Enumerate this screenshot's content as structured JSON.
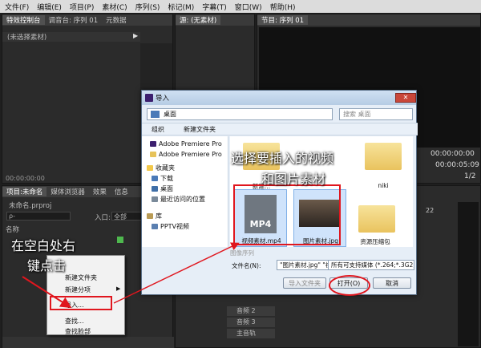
{
  "menubar": [
    "文件(F)",
    "编辑(E)",
    "项目(P)",
    "素材(C)",
    "序列(S)",
    "标记(M)",
    "字幕(T)",
    "窗口(W)",
    "帮助(H)"
  ],
  "left_panel": {
    "tabs": [
      "特效控制台",
      "调音台: 序列 01",
      "元数据"
    ],
    "no_selection": "(未选择素材)",
    "timecode": "00:00:00:00"
  },
  "source_panel": {
    "tab": "源: (无素材)"
  },
  "program_panel": {
    "tab": "节目: 序列 01",
    "timecode1": "00:00:00:00",
    "timecode2": "00:00:05:09",
    "zoom_label": "1/2"
  },
  "project_panel": {
    "tabs": [
      "项目:未命名",
      "媒体浏览器",
      "效果",
      "信息"
    ],
    "file": "未命名.prproj",
    "search_placeholder": "ρ-",
    "entry_label": "入口:",
    "entry_value": "全部",
    "name_col": "名称"
  },
  "timeline": {
    "tracks": [
      "音频 2",
      "音频 3",
      "主音轨"
    ],
    "frame_num": "22"
  },
  "context_menu": {
    "items": [
      "新建文件夹",
      "新建分项",
      "导入...",
      "查找...",
      "查找脸部"
    ]
  },
  "dialog": {
    "title": "导入",
    "address": "桌面",
    "search_placeholder": "搜索 桌面",
    "toolbar": {
      "organize": "组织",
      "new_folder": "新建文件夹"
    },
    "nav": [
      "Adobe Premiere Pro",
      "Adobe Premiere Pro",
      "收藏夹",
      "下载",
      "桌面",
      "最近访问的位置",
      "库",
      "PPTV视频"
    ],
    "files": [
      "新建...",
      "niki",
      "视频素材.mp4",
      "图片素材.jpg",
      "资源压缩包"
    ],
    "mp4_label": "MP4",
    "image_sequence": "图像序列",
    "filename_label": "文件名(N):",
    "filename_value": "\"图片素材.jpg\" \"视频素材.mp4\"",
    "filetype_value": "所有可支持媒体 (*.264;*.3G2;*",
    "import_folder": "导入文件夹",
    "open": "打开(O)",
    "cancel": "取消"
  },
  "annotations": {
    "select": "选择要插入的视频",
    "select2": "和图片素材",
    "rightclick": "在空白处右",
    "rightclick2": "键点击"
  },
  "colors": {
    "highlight": "#e0161e",
    "ps_icon": "#3c1f6e"
  }
}
